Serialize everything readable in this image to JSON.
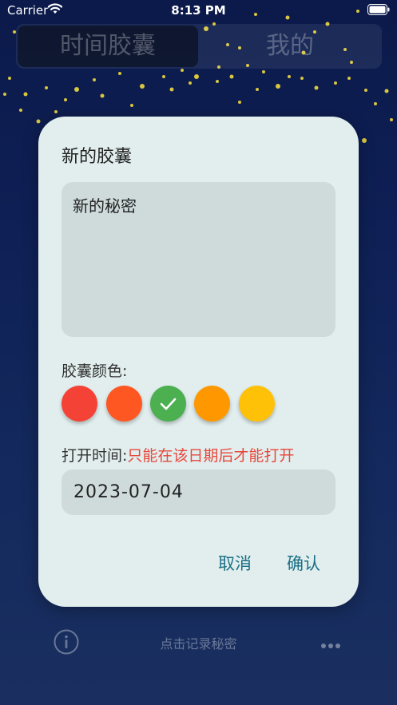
{
  "status_bar": {
    "carrier": "Carrier",
    "time": "8:13 PM"
  },
  "segment": {
    "tabs": [
      {
        "label": "时间胶囊",
        "active": true
      },
      {
        "label": "我的",
        "active": false
      }
    ]
  },
  "dialog": {
    "title": "新的胶囊",
    "content_value": "新的秘密",
    "color_label": "胶囊颜色:",
    "colors": [
      {
        "hex": "#f44336",
        "selected": false
      },
      {
        "hex": "#ff5722",
        "selected": false
      },
      {
        "hex": "#4caf50",
        "selected": true
      },
      {
        "hex": "#ff9800",
        "selected": false
      },
      {
        "hex": "#ffc107",
        "selected": false
      }
    ],
    "open_time_label": "打开时间:",
    "open_time_hint": "只能在该日期后才能打开",
    "date_value": "2023-07-04",
    "cancel_label": "取消",
    "confirm_label": "确认"
  },
  "bottom_bar": {
    "info_icon": "info-icon",
    "record_label": "点击记录秘密",
    "more_icon": "more-icon"
  },
  "accent_colors": {
    "dialog_bg": "#e1eeed",
    "button_text": "#1a6f86",
    "hint_text": "#e8473d"
  }
}
